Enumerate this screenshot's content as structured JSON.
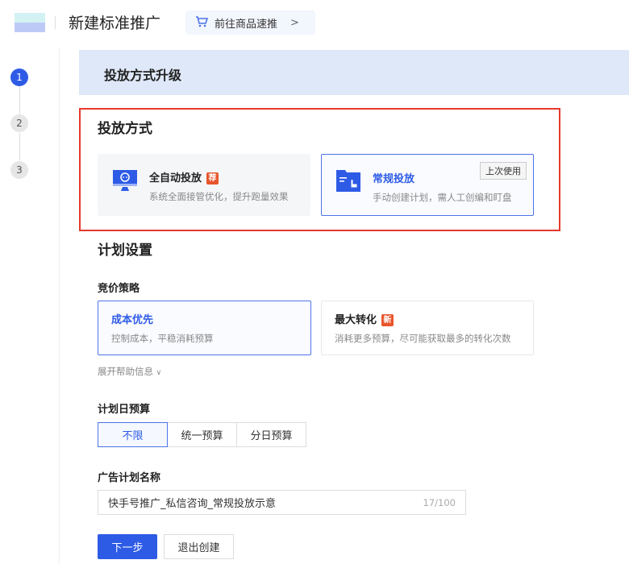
{
  "header": {
    "title": "新建标准推广",
    "goto_label": "前往商品速推"
  },
  "steps": [
    "1",
    "2",
    "3"
  ],
  "banner": {
    "title": "投放方式升级"
  },
  "delivery": {
    "title": "投放方式",
    "options": [
      {
        "title": "全自动投放",
        "badge": "荐",
        "desc": "系统全面接管优化，提升跑量效果",
        "icon": "monitor-robot-icon"
      },
      {
        "title": "常规投放",
        "tag": "上次使用",
        "desc": "手动创建计划，需人工创编和盯盘",
        "icon": "folder-hand-icon"
      }
    ]
  },
  "plan": {
    "title": "计划设置",
    "bid_label": "竞价策略",
    "bid_options": [
      {
        "title": "成本优先",
        "desc": "控制成本，平稳消耗预算"
      },
      {
        "title": "最大转化",
        "badge": "新",
        "desc": "消耗更多预算，尽可能获取最多的转化次数"
      }
    ],
    "help": "展开帮助信息",
    "budget_label": "计划日预算",
    "budget_options": [
      "不限",
      "统一预算",
      "分日预算"
    ],
    "name_label": "广告计划名称",
    "name_value": "快手号推广_私信咨询_常规投放示意",
    "name_count": "17/100"
  },
  "actions": {
    "next": "下一步",
    "exit": "退出创建"
  },
  "colors": {
    "primary": "#2e5be6",
    "highlight": "#e6392c",
    "badge": "#e8552b"
  }
}
